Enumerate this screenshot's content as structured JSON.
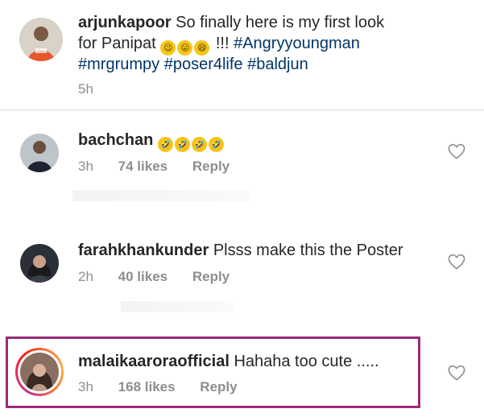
{
  "caption": {
    "username": "arjunkapoor",
    "text_line1": "So finally here is my first look",
    "text_line2_start": "for Panipat",
    "emojis": [
      "😉",
      "😛",
      "😄"
    ],
    "exclaim": "!!!",
    "hashtag_line1": "#Angryyoungman",
    "hashtags_line2": [
      "#mrgrumpy",
      "#poser4life",
      "#baldjun"
    ],
    "time": "5h"
  },
  "comments": [
    {
      "username": "bachchan",
      "text": "",
      "emojis": [
        "🤣",
        "🤣",
        "🤣",
        "🤣"
      ],
      "time": "3h",
      "likes": "74 likes",
      "reply": "Reply"
    },
    {
      "username": "farahkhankunder",
      "text": "Plsss make this the Poster",
      "time": "2h",
      "likes": "40 likes",
      "reply": "Reply"
    },
    {
      "username": "malaikaaroraofficial",
      "text": "Hahaha too cute .....",
      "time": "3h",
      "likes": "168 likes",
      "reply": "Reply"
    }
  ],
  "icons": {
    "like": "heart-outline-icon"
  },
  "colors": {
    "highlight_border": "#9b2a7a",
    "hashtag": "#003569",
    "meta": "#8e8e8e"
  }
}
